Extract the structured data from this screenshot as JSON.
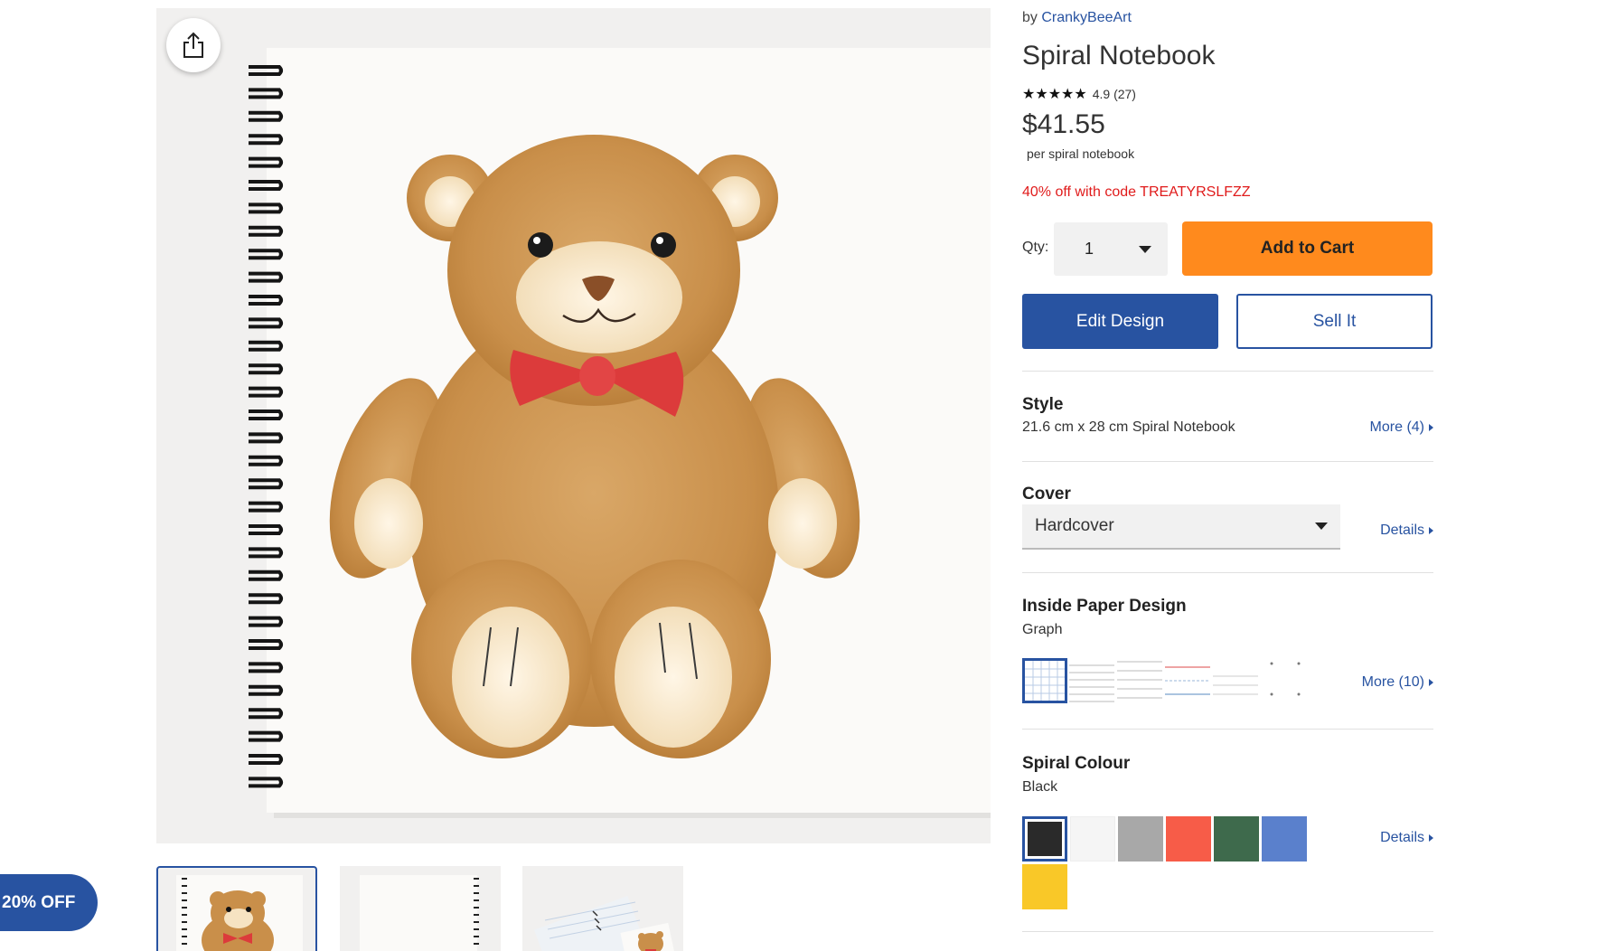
{
  "product": {
    "by_prefix": "by",
    "seller": "CrankyBeeArt",
    "title": "Spiral Notebook",
    "stars": "★★★★★",
    "rating": "4.9 (27)",
    "price": "$41.55",
    "per_unit": "per spiral notebook",
    "promo": "40% off with code TREATYRSLFZZ"
  },
  "purchase": {
    "qty_label": "Qty:",
    "qty_value": "1",
    "add_to_cart": "Add to Cart",
    "edit_design": "Edit Design",
    "sell_it": "Sell It"
  },
  "options": {
    "style": {
      "title": "Style",
      "value": "21.6 cm x 28 cm Spiral Notebook",
      "more": "More (4)"
    },
    "cover": {
      "title": "Cover",
      "selected": "Hardcover",
      "details": "Details"
    },
    "paper": {
      "title": "Inside Paper Design",
      "value": "Graph",
      "more": "More (10)",
      "designs": [
        "graph",
        "lined",
        "lined-wide",
        "lined-red-blue",
        "lined-light",
        "dot"
      ]
    },
    "spiral": {
      "title": "Spiral Colour",
      "value": "Black",
      "details": "Details",
      "colors": [
        "#2a2a2a",
        "#f5f5f5",
        "#a8a8a8",
        "#f75c48",
        "#3e6a4c",
        "#5a80cc",
        "#f9c828"
      ]
    }
  },
  "promo_pill": "20% OFF",
  "colors": {
    "accent_blue": "#2853a1",
    "cart_orange": "#ff8a1d",
    "promo_red": "#e01b1b"
  },
  "icons": {
    "share": "share-icon"
  }
}
